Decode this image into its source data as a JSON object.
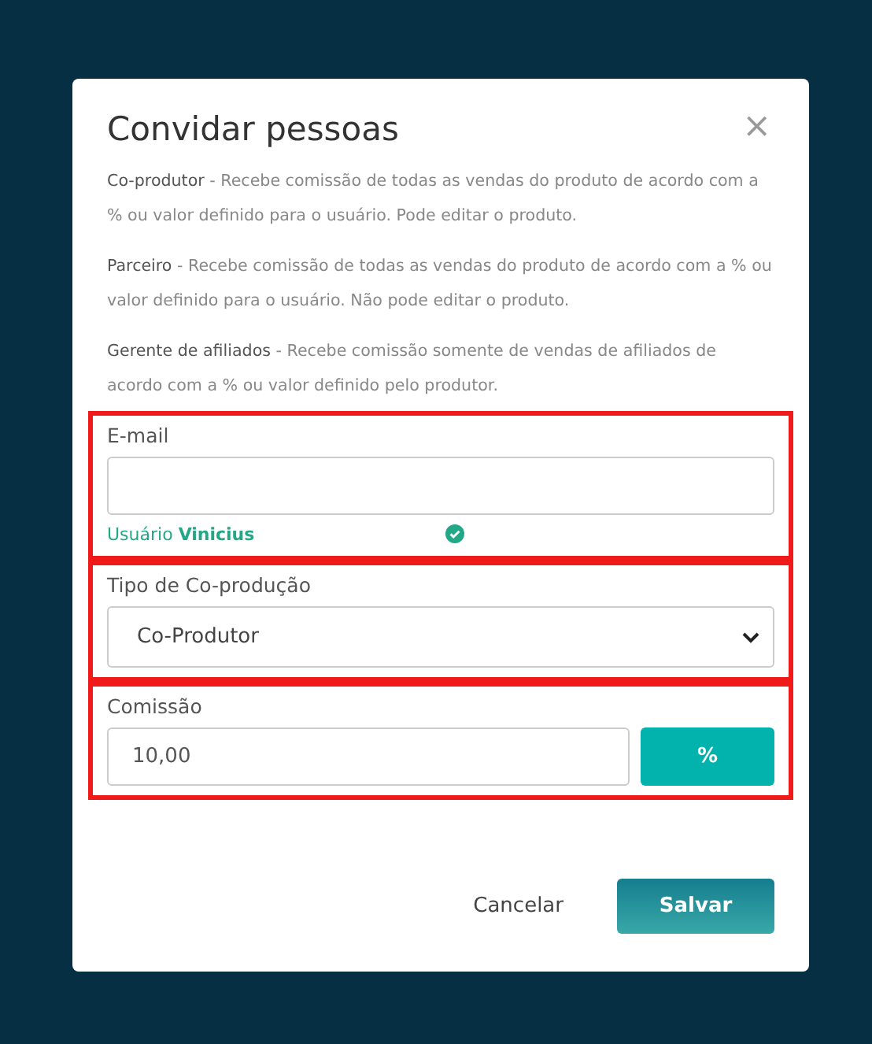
{
  "dialog": {
    "title": "Convidar pessoas",
    "close": "×",
    "descriptions": [
      "**Co-produtor** - Recebe comissão de todas as vendas do produto de acordo com a % ou valor definido para o usuário. Pode editar o produto.",
      "**Parceiro** - Recebe comissão de todas as vendas do produto de acordo com a % ou valor definido para o usuário. Não pode editar o produto.",
      "**Gerente de afiliados** - Recebe comissão somente de vendas de afiliados de acordo com a % ou valor definido pelo produtor."
    ],
    "email": {
      "label": "E-mail",
      "hint": "Usuário **Vinicius**",
      "verified": true
    },
    "type": {
      "label": "Tipo de Co-produção",
      "value": "Co-Produtor"
    },
    "commission": {
      "label": "Comissão",
      "value": "10,00",
      "unit": "%"
    },
    "buttons": [
      {
        "label": "Cancelar",
        "kind": "secondary"
      },
      {
        "label": "Salvar",
        "kind": "primary"
      }
    ]
  }
}
